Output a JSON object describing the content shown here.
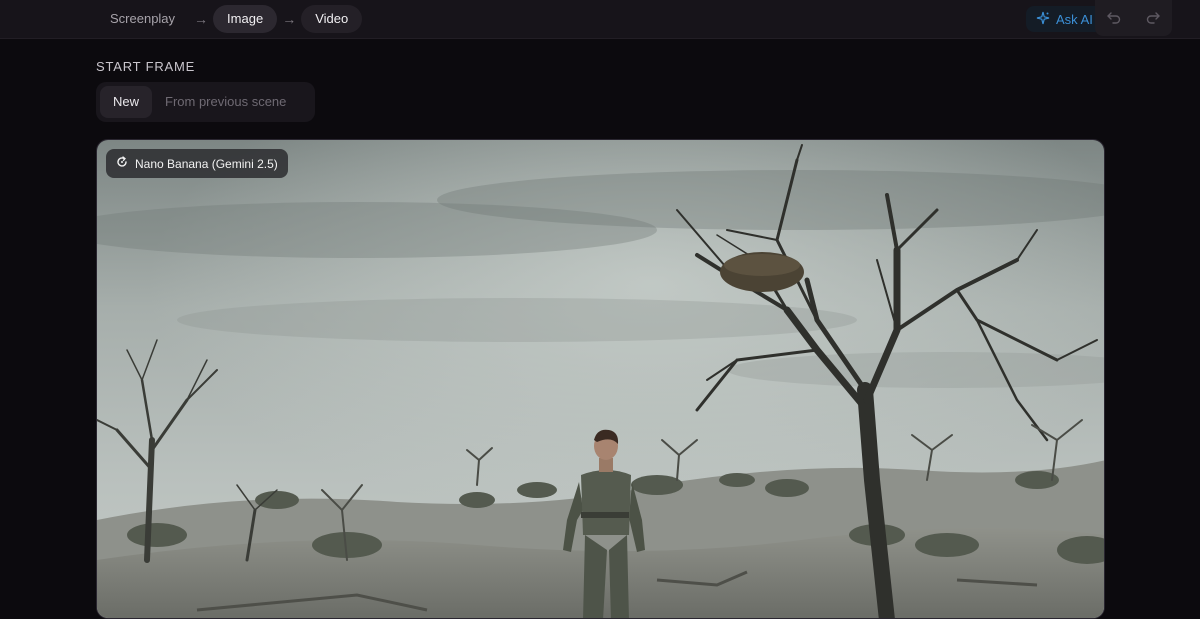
{
  "breadcrumb": {
    "steps": [
      {
        "label": "Screenplay"
      },
      {
        "label": "Image"
      },
      {
        "label": "Video"
      }
    ]
  },
  "ask_ai": {
    "label": "Ask AI",
    "icon": "sparkle-icon",
    "accent": "#3b8fd6"
  },
  "history": {
    "undo_icon": "undo-icon",
    "redo_icon": "redo-icon"
  },
  "start_frame": {
    "title": "START FRAME",
    "options": [
      {
        "label": "New",
        "selected": true
      },
      {
        "label": "From previous scene",
        "selected": false
      }
    ]
  },
  "image": {
    "model_badge": "Nano Banana (Gemini 2.5)",
    "model_icon": "refresh-icon"
  }
}
